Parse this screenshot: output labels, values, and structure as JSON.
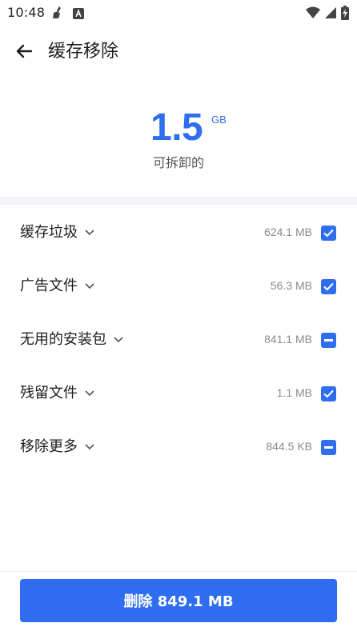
{
  "status_bar": {
    "time": "10:48",
    "left_icons": [
      "cleaner-broom-icon",
      "text-a-icon"
    ],
    "right_icons": [
      "wifi-icon",
      "signal-icon",
      "battery-charging-icon"
    ]
  },
  "header": {
    "title": "缓存移除",
    "back_icon": "arrow-back-icon"
  },
  "summary": {
    "value": "1.5",
    "unit": "GB",
    "caption": "可拆卸的"
  },
  "items": [
    {
      "label": "缓存垃圾",
      "size": "624.1 MB",
      "state": "checked"
    },
    {
      "label": "广告文件",
      "size": "56.3 MB",
      "state": "checked"
    },
    {
      "label": "无用的安装包",
      "size": "841.1 MB",
      "state": "partial"
    },
    {
      "label": "残留文件",
      "size": "1.1 MB",
      "state": "checked"
    },
    {
      "label": "移除更多",
      "size": "844.5 KB",
      "state": "partial"
    }
  ],
  "action": {
    "delete_label": "删除 849.1 MB"
  },
  "colors": {
    "accent": "#2f6ef0",
    "text_primary": "#1c1c1c",
    "text_secondary": "#8a8a8a",
    "band": "#f4f5f8"
  }
}
